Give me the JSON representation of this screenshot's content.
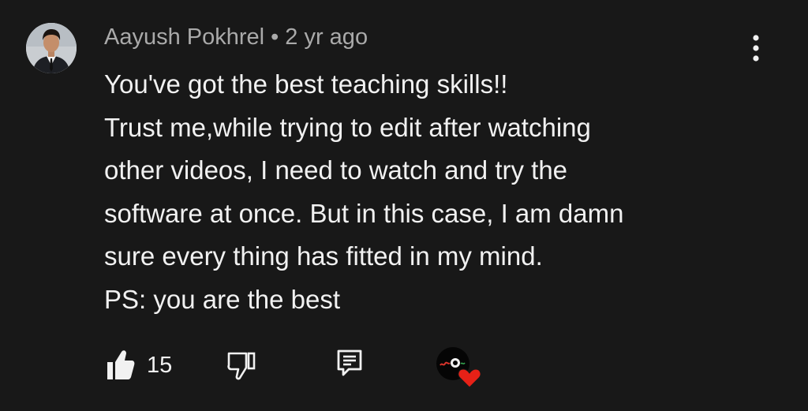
{
  "comment": {
    "author": "Aayush Pokhrel",
    "separator": "•",
    "time": "2 yr ago",
    "text_lines": [
      "You've got the best teaching skills!!",
      "Trust me,while trying to edit after watching",
      "other videos, I need to watch and try the",
      "software at once. But in this case, I am damn",
      "sure every thing has fitted in my mind.",
      "PS: you are the best"
    ]
  },
  "actions": {
    "like_count": "15",
    "icons": [
      "thumbs-up-icon",
      "thumbs-down-icon",
      "reply-icon",
      "creator-heart-icon",
      "more-vert-icon"
    ]
  },
  "colors": {
    "background": "#181818",
    "text": "#f1f1f1",
    "secondary_text": "#aaaaaa",
    "heart": "#e62117"
  }
}
